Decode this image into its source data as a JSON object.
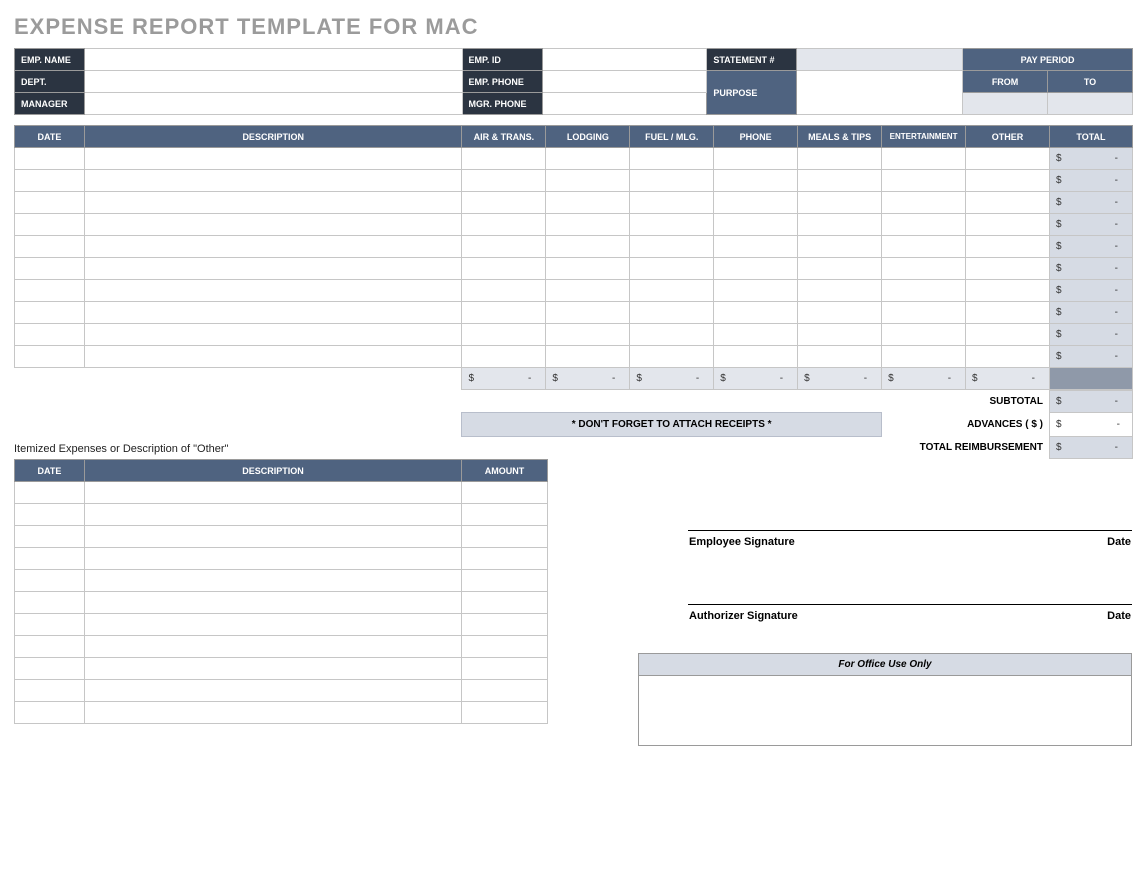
{
  "title": "EXPENSE REPORT TEMPLATE FOR MAC",
  "empInfo": {
    "empName": "EMP. NAME",
    "dept": "DEPT.",
    "manager": "MANAGER",
    "empId": "EMP. ID",
    "empPhone": "EMP. PHONE",
    "mgrPhone": "MGR. PHONE",
    "statementNo": "STATEMENT #",
    "purpose": "PURPOSE",
    "payPeriod": "PAY PERIOD",
    "from": "FROM",
    "to": "TO"
  },
  "cols": {
    "date": "DATE",
    "description": "DESCRIPTION",
    "airTrans": "AIR & TRANS.",
    "lodging": "LODGING",
    "fuelMlg": "FUEL / MLG.",
    "phone": "PHONE",
    "mealsTips": "MEALS & TIPS",
    "entertainment": "ENTERTAINMENT",
    "other": "OTHER",
    "total": "TOTAL",
    "amount": "AMOUNT"
  },
  "summary": {
    "subtotal": "SUBTOTAL",
    "advances": "ADVANCES  ( $ )",
    "totalReimb": "TOTAL REIMBURSEMENT"
  },
  "note": "* DON'T FORGET TO ATTACH RECEIPTS *",
  "itemizedLabel": "Itemized Expenses or Description of \"Other\"",
  "signatures": {
    "employee": "Employee Signature",
    "authorizer": "Authorizer Signature",
    "date": "Date"
  },
  "office": "For Office Use Only",
  "money": {
    "sym": "$",
    "empty": "-"
  }
}
